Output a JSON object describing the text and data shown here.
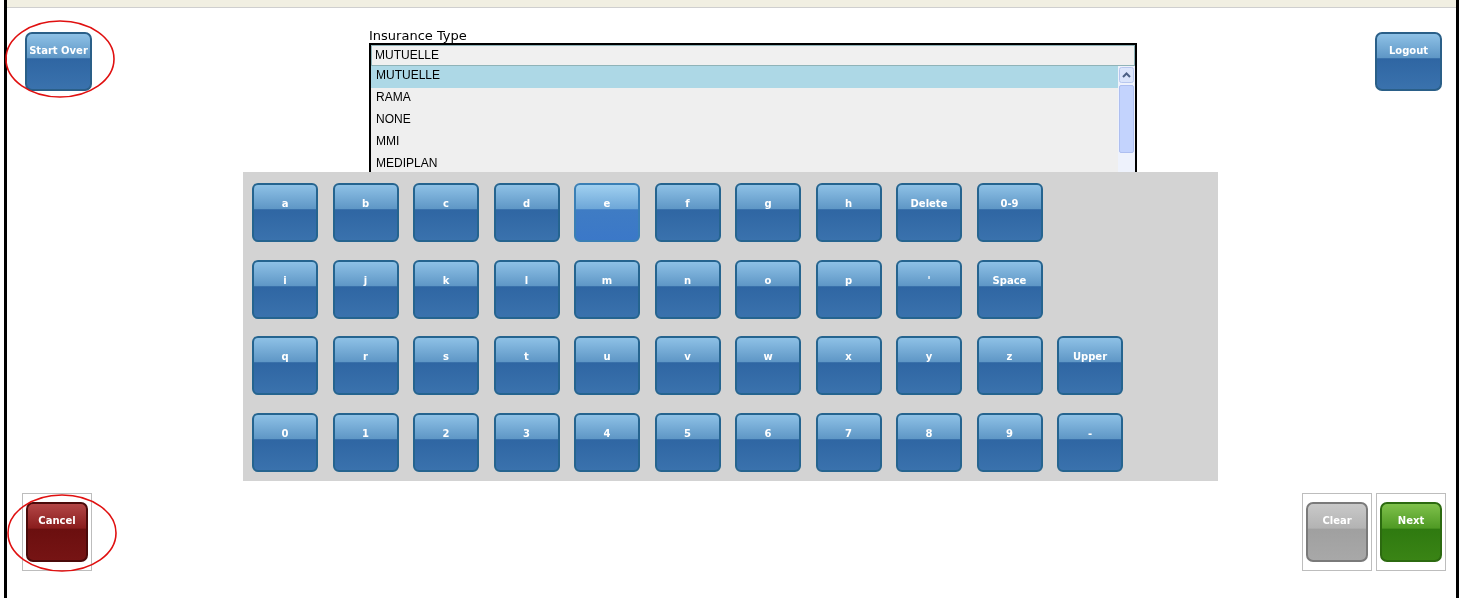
{
  "buttons_top": [
    {
      "label": "Start Over",
      "kind": "primary",
      "circled": true
    },
    {
      "label": "Logout",
      "kind": "primary",
      "circled": false
    }
  ],
  "insurance": {
    "label": "Insurance Type",
    "value": "MUTUELLE",
    "options": [
      {
        "label": "MUTUELLE",
        "selected": true
      },
      {
        "label": "RAMA",
        "selected": false
      },
      {
        "label": "NONE",
        "selected": false
      },
      {
        "label": "MMI",
        "selected": false
      },
      {
        "label": "MEDIPLAN",
        "selected": false
      }
    ]
  },
  "keyboard": [
    [
      {
        "label": "a",
        "highlighted": false
      },
      {
        "label": "b",
        "highlighted": false
      },
      {
        "label": "c",
        "highlighted": false
      },
      {
        "label": "d",
        "highlighted": false
      },
      {
        "label": "e",
        "highlighted": true
      },
      {
        "label": "f",
        "highlighted": false
      },
      {
        "label": "g",
        "highlighted": false
      },
      {
        "label": "h",
        "highlighted": false
      },
      {
        "label": "Delete",
        "highlighted": false
      },
      {
        "label": "0-9",
        "highlighted": false
      }
    ],
    [
      {
        "label": "i",
        "highlighted": false
      },
      {
        "label": "j",
        "highlighted": false
      },
      {
        "label": "k",
        "highlighted": false
      },
      {
        "label": "l",
        "highlighted": false
      },
      {
        "label": "m",
        "highlighted": false
      },
      {
        "label": "n",
        "highlighted": false
      },
      {
        "label": "o",
        "highlighted": false
      },
      {
        "label": "p",
        "highlighted": false
      },
      {
        "label": "'",
        "highlighted": false
      },
      {
        "label": "Space",
        "highlighted": false
      }
    ],
    [
      {
        "label": "q",
        "highlighted": false
      },
      {
        "label": "r",
        "highlighted": false
      },
      {
        "label": "s",
        "highlighted": false
      },
      {
        "label": "t",
        "highlighted": false
      },
      {
        "label": "u",
        "highlighted": false
      },
      {
        "label": "v",
        "highlighted": false
      },
      {
        "label": "w",
        "highlighted": false
      },
      {
        "label": "x",
        "highlighted": false
      },
      {
        "label": "y",
        "highlighted": false
      },
      {
        "label": "z",
        "highlighted": false
      },
      {
        "label": "Upper",
        "highlighted": false
      }
    ],
    [
      {
        "label": "0",
        "highlighted": false
      },
      {
        "label": "1",
        "highlighted": false
      },
      {
        "label": "2",
        "highlighted": false
      },
      {
        "label": "3",
        "highlighted": false
      },
      {
        "label": "4",
        "highlighted": false
      },
      {
        "label": "5",
        "highlighted": false
      },
      {
        "label": "6",
        "highlighted": false
      },
      {
        "label": "7",
        "highlighted": false
      },
      {
        "label": "8",
        "highlighted": false
      },
      {
        "label": "9",
        "highlighted": false
      },
      {
        "label": "-",
        "highlighted": false
      }
    ]
  ],
  "buttons_bottom_left": [
    {
      "label": "Cancel",
      "kind": "danger",
      "circled": true
    }
  ],
  "buttons_bottom_right": [
    {
      "label": "Clear",
      "kind": "neutral",
      "circled": false
    },
    {
      "label": "Next",
      "kind": "confirm",
      "circled": false
    }
  ]
}
